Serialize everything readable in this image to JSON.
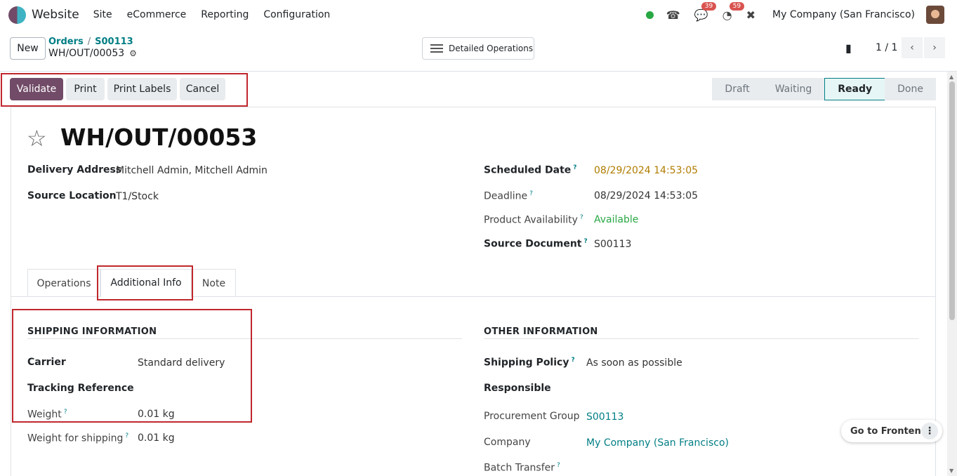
{
  "nav": {
    "brand": "Website",
    "menu": [
      "Site",
      "eCommerce",
      "Reporting",
      "Configuration"
    ],
    "chat_badge": "39",
    "activity_badge": "59",
    "company": "My Company (San Francisco)"
  },
  "control": {
    "new_label": "New",
    "breadcrumb": [
      "Orders",
      "S00113"
    ],
    "record_name": "WH/OUT/00053",
    "detailed_ops_label": "Detailed Operations",
    "pager": "1 / 1"
  },
  "actions": {
    "validate": "Validate",
    "print": "Print",
    "print_labels": "Print Labels",
    "cancel": "Cancel"
  },
  "status": [
    "Draft",
    "Waiting",
    "Ready",
    "Done"
  ],
  "status_active": "Ready",
  "form": {
    "title": "WH/OUT/00053",
    "delivery_address_label": "Delivery Address",
    "delivery_address": "Mitchell Admin, Mitchell Admin",
    "source_location_label": "Source Location",
    "source_location": "T1/Stock",
    "scheduled_date_label": "Scheduled Date",
    "scheduled_date": "08/29/2024 14:53:05",
    "deadline_label": "Deadline",
    "deadline": "08/29/2024 14:53:05",
    "product_availability_label": "Product Availability",
    "product_availability": "Available",
    "source_document_label": "Source Document",
    "source_document": "S00113"
  },
  "tabs": [
    "Operations",
    "Additional Info",
    "Note"
  ],
  "active_tab": "Additional Info",
  "shipping": {
    "heading": "SHIPPING INFORMATION",
    "carrier_label": "Carrier",
    "carrier": "Standard delivery",
    "tracking_label": "Tracking Reference",
    "weight_label": "Weight",
    "weight": "0.01",
    "weight_unit": "kg",
    "weight_shipping_label": "Weight for shipping",
    "weight_shipping": "0.01",
    "weight_shipping_unit": "kg"
  },
  "other": {
    "heading": "OTHER INFORMATION",
    "shipping_policy_label": "Shipping Policy",
    "shipping_policy": "As soon as possible",
    "responsible_label": "Responsible",
    "procurement_group_label": "Procurement Group",
    "procurement_group": "S00113",
    "company_label": "Company",
    "company": "My Company (San Francisco)",
    "batch_transfer_label": "Batch Transfer"
  },
  "floating": {
    "go_to_frontend": "Go to Frontend"
  },
  "help_mark": "?",
  "colors": {
    "primary": "#714b67",
    "link": "#017e84",
    "highlight_box": "#c0272d",
    "available": "#28a745",
    "scheduled": "#b07c00"
  }
}
